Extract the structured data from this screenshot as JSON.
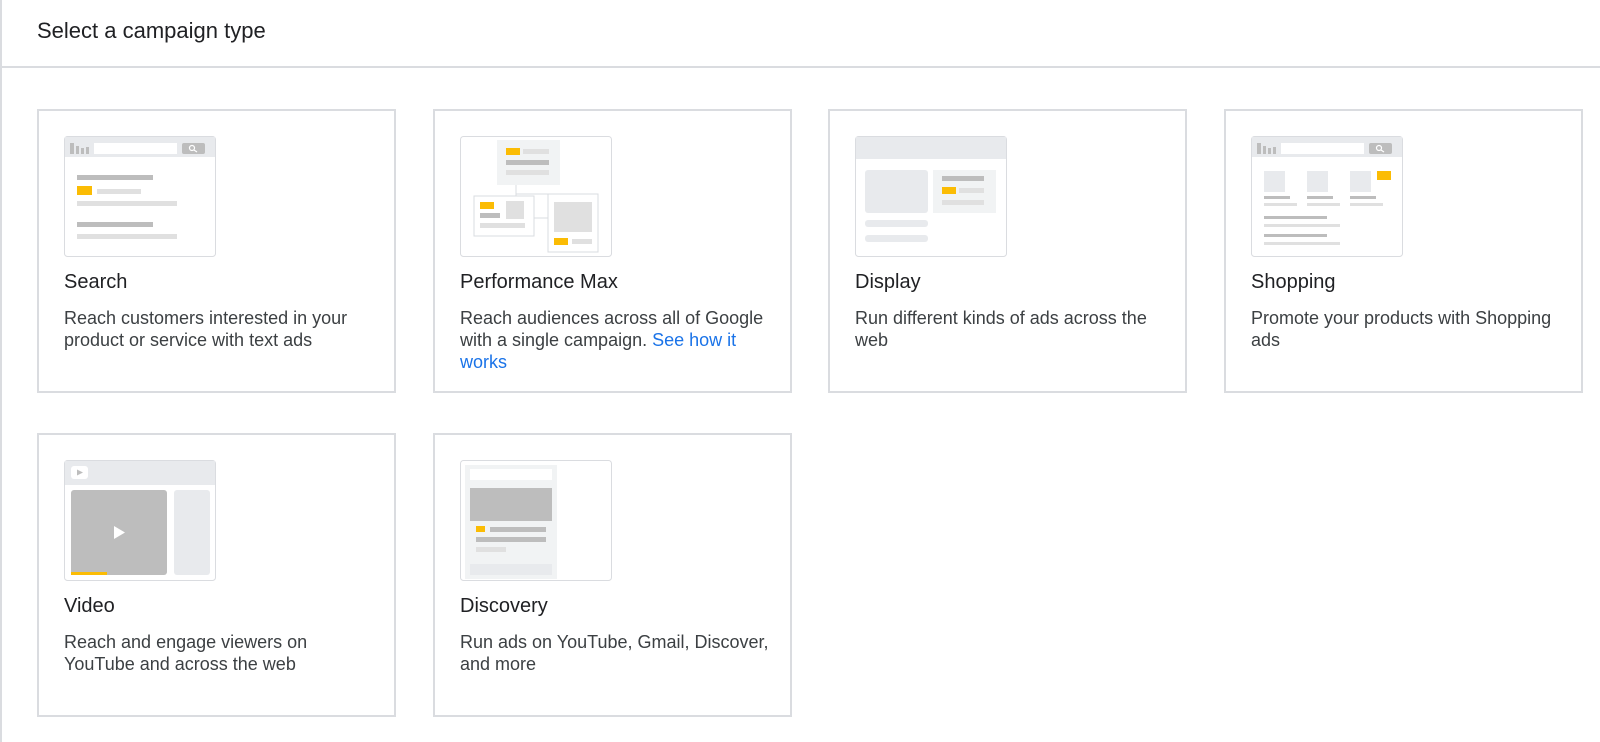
{
  "header": {
    "title": "Select a campaign type"
  },
  "colors": {
    "accent_yellow": "#fbbc04",
    "link_blue": "#1a73e8",
    "border": "#dadce0"
  },
  "campaign_types": [
    {
      "name": "Search",
      "description": "Reach customers interested in your product or service with text ads",
      "icon": "search-illustration-icon"
    },
    {
      "name": "Performance Max",
      "description": "Reach audiences across all of Google with a single campaign.",
      "link": "See how it works",
      "icon": "performance-max-illustration-icon"
    },
    {
      "name": "Display",
      "description": "Run different kinds of ads across the web",
      "icon": "display-illustration-icon"
    },
    {
      "name": "Shopping",
      "description": "Promote your products with Shopping ads",
      "icon": "shopping-illustration-icon"
    },
    {
      "name": "Video",
      "description": "Reach and engage viewers on YouTube and across the web",
      "icon": "video-illustration-icon"
    },
    {
      "name": "Discovery",
      "description": "Run ads on YouTube, Gmail, Discover, and more",
      "icon": "discovery-illustration-icon"
    }
  ]
}
